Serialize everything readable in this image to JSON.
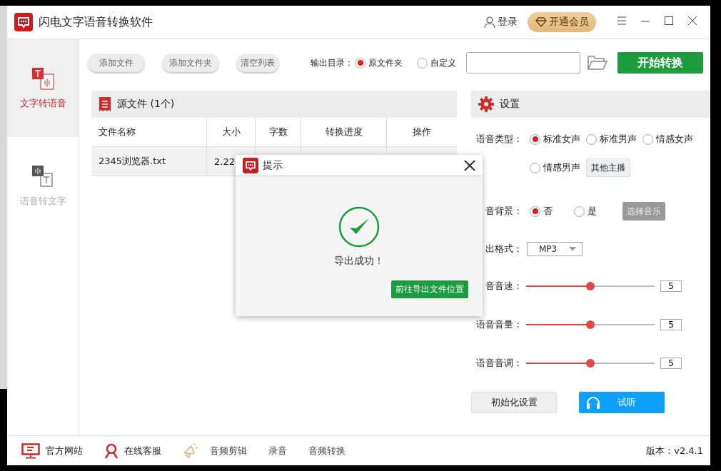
{
  "window": {
    "title": "闪电文字语音转换软件",
    "login": "登录",
    "vip": "开通会员"
  },
  "sidebar": {
    "items": [
      {
        "label": "文字转语音",
        "selected": true
      },
      {
        "label": "语音转文字",
        "selected": false
      }
    ]
  },
  "toolbar": {
    "buttons": [
      "添加文件",
      "添加文件夹",
      "清空列表"
    ],
    "output_label": "输出目录：",
    "output_options": [
      {
        "label": "原文件夹",
        "selected": true
      },
      {
        "label": "自定义",
        "selected": false
      }
    ],
    "start": "开始转换"
  },
  "file_table": {
    "title": "源文件 (1个)",
    "columns": [
      "文件名称",
      "大小",
      "字数",
      "转换进度",
      "操作"
    ],
    "rows": [
      [
        "2345浏览器.txt",
        "2.22"
      ]
    ]
  },
  "settings": {
    "title": "设置",
    "voice_label": "语音类型：",
    "voices": [
      {
        "label": "标准女声",
        "selected": true
      },
      {
        "label": "标准男声",
        "selected": false
      },
      {
        "label": "情感女声",
        "selected": false
      },
      {
        "label": "情感男声",
        "selected": false
      }
    ],
    "other_voices": "其他主播",
    "bg_label": "音背景：",
    "bg_options": [
      {
        "label": "否",
        "selected": true
      },
      {
        "label": "是",
        "selected": false
      }
    ],
    "choose_music": "选择音乐",
    "format_label": "出格式：",
    "format": "MP3",
    "sliders": [
      {
        "label": "音音速：",
        "level": 0.5,
        "value": "5"
      },
      {
        "label": "语音音量：",
        "level": 0.5,
        "value": "5"
      },
      {
        "label": "语音音调：",
        "level": 0.5,
        "value": "5"
      }
    ],
    "reset": "初始化设置",
    "preview": "试听"
  },
  "dialog": {
    "title": "提示",
    "message": "导出成功！",
    "button": "前往导出文件位置"
  },
  "footer": {
    "links": [
      {
        "label": "官方网站",
        "kind": "monitor"
      },
      {
        "label": "在线客服",
        "kind": "person"
      },
      {
        "label": "音频剪辑",
        "kind": "megaphone"
      },
      {
        "label": "录音",
        "kind": "text"
      },
      {
        "label": "音频转换",
        "kind": "text"
      }
    ],
    "version": "版本：v2.4.1"
  }
}
